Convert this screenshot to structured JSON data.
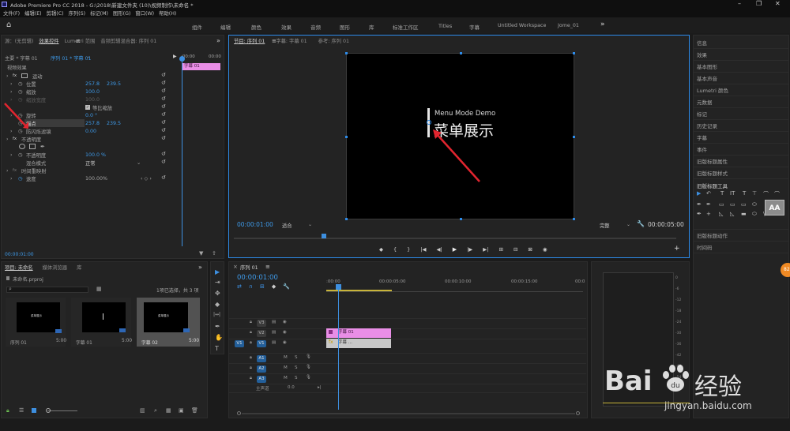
{
  "app": {
    "title": "Adobe Premiere Pro CC 2018 - G:\\2018\\新建文件夹 (10)\\视频制作\\未命名 *"
  },
  "menubar": [
    "文件(F)",
    "编辑(E)",
    "剪辑(C)",
    "序列(S)",
    "标记(M)",
    "图形(G)",
    "窗口(W)",
    "帮助(H)"
  ],
  "workspaces": [
    "组件",
    "编辑",
    "颜色",
    "效果",
    "音频",
    "图形",
    "库",
    "标准工作区",
    "Titles",
    "字幕",
    "Untitled Workspace",
    "Jome_01"
  ],
  "workspaces_more": "»",
  "effect_controls": {
    "tabs": [
      "源：(无剪辑)",
      "效果控件",
      "Lumetri 范围",
      "音频剪辑混合器: 序列 01"
    ],
    "menu_icon": "≡",
    "expand_icon": "»",
    "master": "主要 * 字幕 01",
    "clip": "序列 01 * 字幕 01",
    "time_start": ":00:00",
    "time_end": "00:00",
    "clip_bar": "字幕 01",
    "video_effects": "视频效果",
    "rows": [
      {
        "label": "运动",
        "value": "",
        "value2": ""
      },
      {
        "label": "位置",
        "value": "257.8",
        "value2": "239.5"
      },
      {
        "label": "缩放",
        "value": "100.0",
        "value2": ""
      },
      {
        "label": "缩放宽度",
        "value": "100.0",
        "value2": ""
      },
      {
        "label": "等比缩放",
        "value": "",
        "value2": ""
      },
      {
        "label": "旋转",
        "value": "0.0 °",
        "value2": ""
      },
      {
        "label": "锚点",
        "value": "257.8",
        "value2": "239.5"
      },
      {
        "label": "防闪烁滤镜",
        "value": "0.00",
        "value2": ""
      },
      {
        "label": "不透明度",
        "value": "",
        "value2": ""
      },
      {
        "label": "不透明度",
        "value": "100.0 %",
        "value2": ""
      },
      {
        "label": "混合模式",
        "value": "正常",
        "value2": ""
      },
      {
        "label": "时间重映射",
        "value": "",
        "value2": ""
      },
      {
        "label": "速度",
        "value": "100.00%",
        "value2": ""
      }
    ],
    "speed_nav": "‹ ◇ ›",
    "timecode": "00:00:01:00"
  },
  "program": {
    "tabs": [
      "节目: 序列 01",
      "字幕: 字幕 01",
      "参考: 序列 01"
    ],
    "menu_icon": "≡",
    "title_small": "Menu Mode Demo",
    "title_big": "菜单展示",
    "timecode": "00:00:01:00",
    "fit": "适合",
    "quality": "完整",
    "duration": "00:00:05:00",
    "controls": [
      "◆",
      "{",
      "}",
      "|◀",
      "◀|",
      "▶",
      "|▶",
      "▶|",
      "⊞",
      "⊟",
      "⊠",
      "◉"
    ],
    "add_button": "+"
  },
  "project": {
    "tabs": [
      "项目: 未命名",
      "媒体浏览器",
      "库"
    ],
    "expand_icon": "»",
    "file": "未命名.prproj",
    "selected": "1项已选择，共 3 项",
    "items": [
      {
        "name": "序列 01",
        "dur": "5:00",
        "text": "菜单展示"
      },
      {
        "name": "字幕 01",
        "dur": "5:00",
        "text": ""
      },
      {
        "name": "字幕 02",
        "dur": "5:00",
        "text": "菜单展示"
      }
    ]
  },
  "timeline": {
    "tab": "序列 01",
    "menu_icon": "≡",
    "timecode": "00:00:01:00",
    "ruler": [
      ":00:00",
      "00:00:05:00",
      "00:00:10:00",
      "00:00:15:00",
      "00:0"
    ],
    "video_tracks": [
      "V3",
      "V2",
      "V1"
    ],
    "source_v": "V1",
    "audio_tracks": [
      "A1",
      "A2",
      "A3"
    ],
    "master": "主声道",
    "master_value": "0.0",
    "clips": [
      "字幕 01",
      "字幕 ..."
    ]
  },
  "tools": [
    "▶",
    "⇥",
    "✥",
    "◆",
    "|↔|",
    "✒",
    "✋",
    "T"
  ],
  "meter_labels": [
    "0",
    "-6",
    "-12",
    "-18",
    "-24",
    "-30",
    "-36",
    "-42",
    "-48",
    "-54"
  ],
  "right_panels": [
    "信息",
    "效果",
    "基本图形",
    "基本声音",
    "Lumetri 颜色",
    "元数据",
    "标记",
    "历史记录",
    "字幕",
    "事件",
    "旧版标题属性",
    "旧版标题样式",
    "旧版标题工具",
    "旧版标题动作",
    "时间码"
  ],
  "legacy_tools": [
    "▶",
    "↶",
    "T",
    "IT",
    "T",
    "⊤",
    "⌒",
    "⌒",
    "✒",
    "✒",
    "✒",
    "+",
    "▭",
    "▭",
    "▭",
    "⬭",
    "◺",
    "◺",
    "▬",
    "⬭",
    "\\",
    "AA"
  ],
  "watermark": {
    "brand": "Bai",
    "brand2": "du",
    "cn": "经验",
    "url": "jingyan.baidu.com"
  },
  "badge": "82",
  "colors": {
    "accent": "#2d8ceb",
    "clip_pink": "#e98ee6",
    "clip_gray": "#c8c8c8",
    "playhead": "#3d8fe0"
  }
}
